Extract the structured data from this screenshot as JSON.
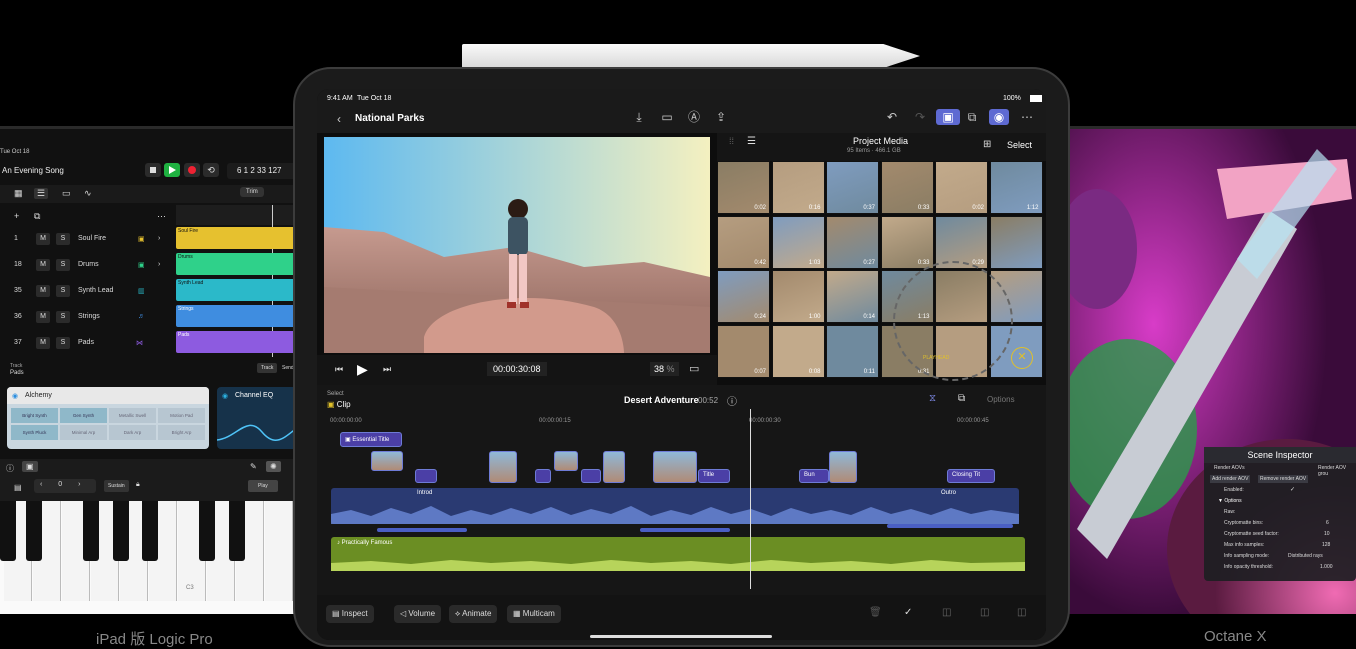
{
  "captions": {
    "left": "iPad 版 Logic Pro",
    "right": "Octane X"
  },
  "logic": {
    "status_date": "Tue Oct 18",
    "song_title": "An Evening Song",
    "lcd": "6 1 2  33  127",
    "buttons": {
      "trim": "Trim",
      "track": "Track",
      "sends": "Sends",
      "sustain": "Sustain",
      "play": "Play"
    },
    "tracks": [
      {
        "num": "1",
        "name": "Soul Fire",
        "region": "Soul Fire",
        "color": "#e6c12f"
      },
      {
        "num": "18",
        "name": "Drums",
        "region": "Drums",
        "color": "#2fd18a"
      },
      {
        "num": "35",
        "name": "Synth Lead",
        "region": "Synth Lead",
        "color": "#2bb9c9"
      },
      {
        "num": "36",
        "name": "Strings",
        "region": "Strings",
        "color": "#3f8de0"
      },
      {
        "num": "37",
        "name": "Pads",
        "region": "Pads",
        "color": "#8d5be0"
      }
    ],
    "track_label": "Track",
    "track_sub": "Pads",
    "plugins": [
      {
        "title": "Alchemy",
        "cells": [
          "Bright Synth",
          "Gen Synth",
          "Metallic Swell",
          "Motion Pad",
          "Synth Pluck",
          "Minimal Arp",
          "Dark Arp",
          "Bright Arp"
        ]
      },
      {
        "title": "Channel EQ"
      }
    ],
    "octave": "0",
    "key_label": "C3"
  },
  "fcp": {
    "status": {
      "time": "9:41 AM",
      "date": "Tue Oct 18",
      "battery": "100%"
    },
    "project_title": "National Parks",
    "media": {
      "title": "Project Media",
      "subtitle": "95 Items · 466.1 GB",
      "select": "Select"
    },
    "thumbs": [
      "0:02",
      "0:16",
      "0:37",
      "0:33",
      "0:02",
      "1:12",
      "0:42",
      "1:03",
      "0:27",
      "0:33",
      "0:29",
      "",
      "0:24",
      "1:00",
      "0:14",
      "1:13",
      "",
      "",
      "0:07",
      "0:08",
      "0:11",
      "0:31",
      "",
      ""
    ],
    "playhead_label": "PLAYHEAD",
    "timecode": "00:00:30:08",
    "zoom": "38",
    "zoom_unit": "%",
    "timeline": {
      "select_label": "Select",
      "clip_label": "Clip",
      "project": "Desert Adventure",
      "duration": "00:52",
      "options": "Options",
      "ruler": [
        "00:00:00:00",
        "00:00:00:15",
        "00:00:00:30",
        "00:00:00:45"
      ],
      "titles": {
        "essential": "Essential Title",
        "intro": "Introd",
        "title": "Title",
        "bun": "Bun",
        "closing": "Closing Tit",
        "outro": "Outro"
      },
      "music": "Practically Famous"
    },
    "bottom": {
      "inspect": "Inspect",
      "volume": "Volume",
      "animate": "Animate",
      "multicam": "Multicam"
    }
  },
  "octane": {
    "title": "Scene Inspector",
    "tabs": [
      "Render AOVs",
      "Render AOV grou"
    ],
    "add": "Add render AOV",
    "remove": "Remove render AOV",
    "rows": [
      {
        "label": "Enabled:",
        "value": "✓"
      },
      {
        "label": "▼ Options",
        "value": ""
      },
      {
        "label": "Raw:",
        "value": ""
      },
      {
        "label": "Cryptomatte bins:",
        "value": "6"
      },
      {
        "label": "Cryptomatte seed factor:",
        "value": "10"
      },
      {
        "label": "Max info samples:",
        "value": "128"
      },
      {
        "label": "Info sampling mode:",
        "value": "Distributed rays"
      },
      {
        "label": "Info opacity threshold:",
        "value": "1.000"
      }
    ]
  },
  "colors": {
    "fcp_accent": "#5e6ad2",
    "title_clip": "#4b3fa6",
    "audio": "#6b8e23",
    "logic_play": "#1fb141"
  }
}
